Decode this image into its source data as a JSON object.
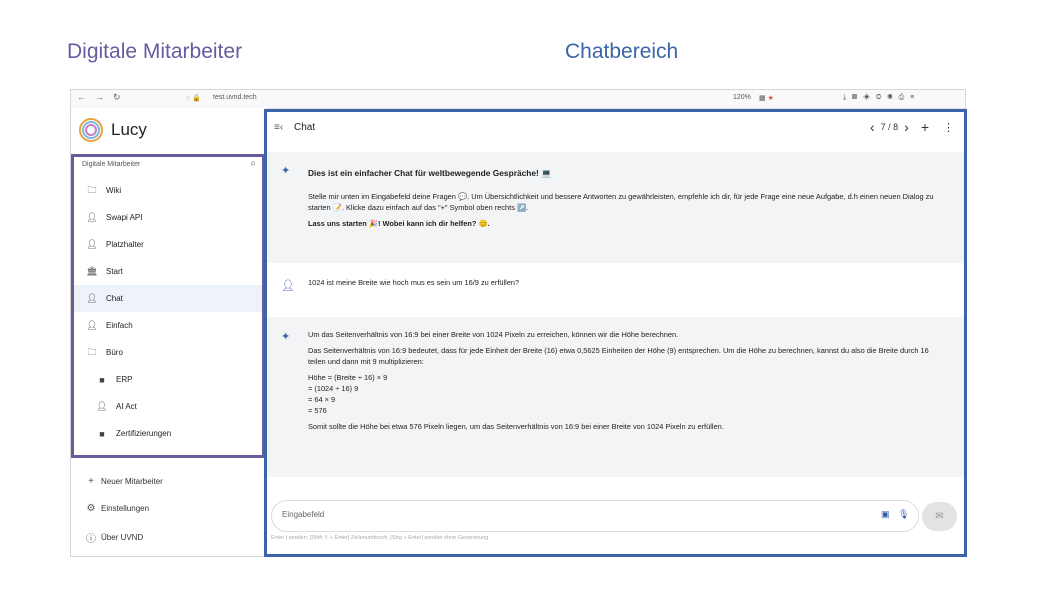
{
  "annotations": {
    "left": "Digitale Mitarbeiter",
    "right": "Chatbereich"
  },
  "browser": {
    "url": "test.uvnd.tech",
    "zoom": "120%"
  },
  "sidebar": {
    "app_name": "Lucy",
    "section_header": "Digitale Mitarbeiter",
    "items": [
      {
        "label": "Wiki",
        "icon": "folder-icon"
      },
      {
        "label": "Swapi API",
        "icon": "person-icon"
      },
      {
        "label": "Platzhalter",
        "icon": "person-icon"
      },
      {
        "label": "Start",
        "icon": "bank-icon"
      },
      {
        "label": "Chat",
        "icon": "person-icon"
      },
      {
        "label": "Einfach",
        "icon": "person-icon"
      },
      {
        "label": "Büro",
        "icon": "folder-icon"
      },
      {
        "label": "ERP",
        "icon": "folder-filled-icon"
      },
      {
        "label": "AI Act",
        "icon": "person-icon"
      },
      {
        "label": "Zertifizierungen",
        "icon": "folder-filled-icon"
      }
    ],
    "bottom": {
      "new_agent": "Neuer Mitarbeiter",
      "settings": "Einstellungen",
      "about": "Über UVND"
    }
  },
  "chat": {
    "title": "Chat",
    "pager": "7 / 8",
    "welcome": {
      "heading": "Dies ist ein einfacher Chat für weltbewegende Gespräche! 💻",
      "text": "Stelle mir unten im Eingabefeld deine Fragen 💬. Um Übersichtlichkeit und bessere Antworten zu gewährleisten, empfehle ich dir, für jede Frage eine neue Aufgabe, d.h einen neuen Dialog zu starten 📝. Klicke dazu einfach auf das \"+\" Symbol oben rechts ↗️.",
      "cta": "Lass uns starten 🎉! Wobei kann ich dir helfen? 😊."
    },
    "user_message": "1024 ist meine Breite wie hoch mus es sein um 16/9 zu erfüllen?",
    "answer": {
      "intro": "Um das Seitenverhältnis von 16:9 bei einer Breite von 1024 Pixeln zu erreichen, können wir die Höhe berechnen.",
      "explanation": "Das Seitenverhältnis von 16:9 bedeutet, dass für jede Einheit der Breite (16) etwa 0,5625 Einheiten der Höhe (9) entsprechen. Um die Höhe zu berechnen, kannst du also die Breite durch 16 teilen und dann mit 9 multiplizieren:",
      "formula": [
        "Höhe = (Breite ÷ 16) × 9",
        "= (1024 ÷ 16) 9",
        "= 64 × 9",
        "= 576"
      ],
      "conclusion": "Somit sollte die Höhe bei etwa 576 Pixeln liegen, um das Seitenverhältnis von 16:9 bei einer Breite von 1024 Pixeln zu erfüllen."
    },
    "input_placeholder": "Eingabefeld",
    "hint": "Enter | senden, [Shift ⇧ + Enter] Zeilenumbruch, [Strg + Enter] senden ohne Generierung"
  },
  "colors": {
    "agents_outline": "#6a5a9e",
    "chat_outline": "#3b64a8",
    "active_item_bg": "#eef3fa"
  }
}
